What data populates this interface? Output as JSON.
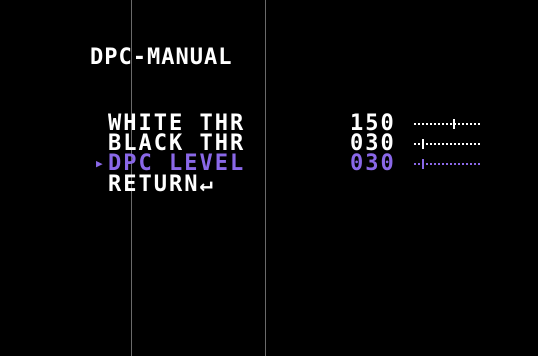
{
  "osd": {
    "title": "DPC-MANUAL",
    "cursor": "▶",
    "items": [
      {
        "label": "WHITE THR",
        "value": "150",
        "level": 0.59
      },
      {
        "label": "BLACK THR",
        "value": "030",
        "level": 0.12
      },
      {
        "label": "DPC LEVEL",
        "value": "030",
        "level": 0.12,
        "selected": true
      },
      {
        "label": "RETURN↵"
      }
    ]
  },
  "colors": {
    "background": "#000000",
    "text": "#ffffff",
    "selected": "#8a68e8"
  }
}
